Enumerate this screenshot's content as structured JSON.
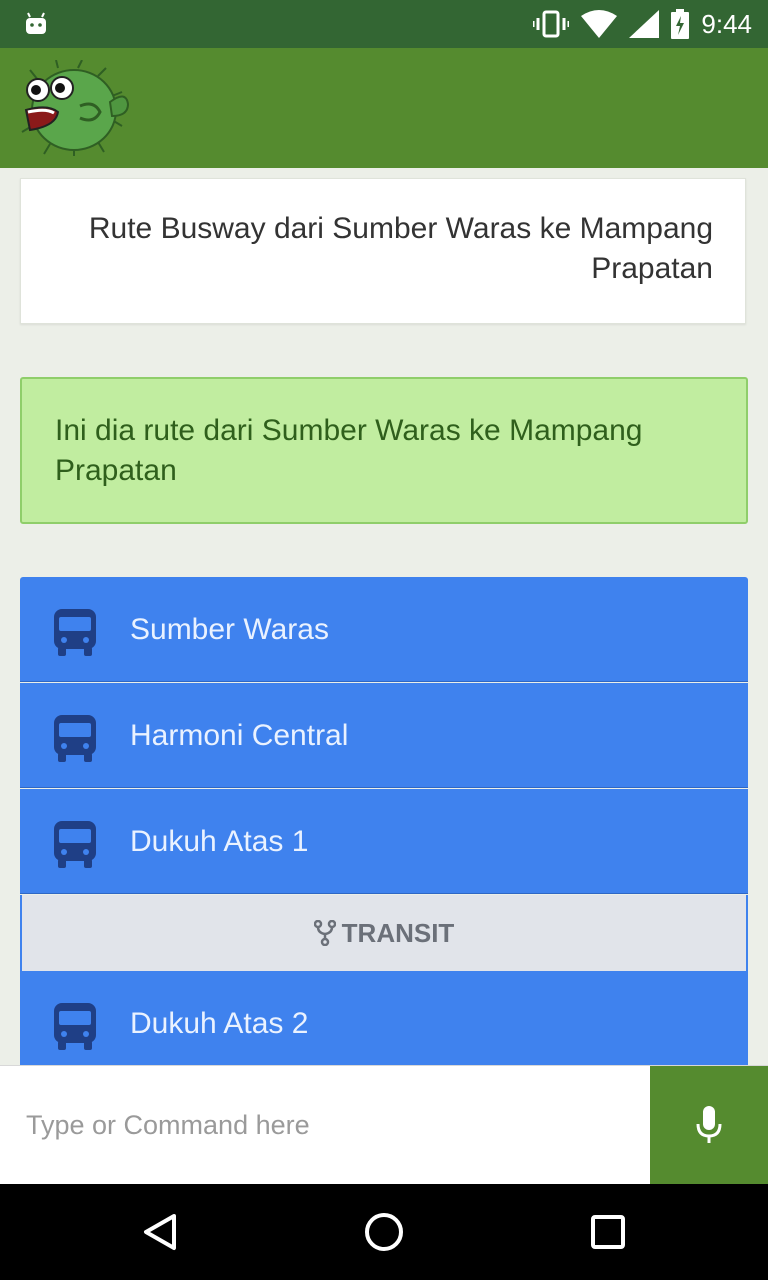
{
  "status_bar": {
    "time": "9:44",
    "icons": [
      "android-icon",
      "vibrate-icon",
      "wifi-icon",
      "signal-icon",
      "battery-charging-icon"
    ]
  },
  "app_bar": {
    "logo": "pufferfish-logo"
  },
  "query": {
    "title": "Rute Busway dari Sumber Waras ke Mampang Prapatan"
  },
  "response": {
    "message": "Ini dia rute dari Sumber Waras ke Mampang Prapatan"
  },
  "route": {
    "stops": [
      {
        "name": "Sumber Waras",
        "icon": "bus-icon"
      },
      {
        "name": "Harmoni Central",
        "icon": "bus-icon"
      },
      {
        "name": "Dukuh Atas 1",
        "icon": "bus-icon"
      },
      {
        "name": "Dukuh Atas 2",
        "icon": "bus-icon"
      }
    ],
    "transit_label": "TRANSIT"
  },
  "input": {
    "placeholder": "Type or Command here",
    "value": ""
  },
  "colors": {
    "status_bar": "#336633",
    "app_bar": "#558b2f",
    "stop_row": "#3f82ee",
    "message_bg": "#c1eda0"
  }
}
